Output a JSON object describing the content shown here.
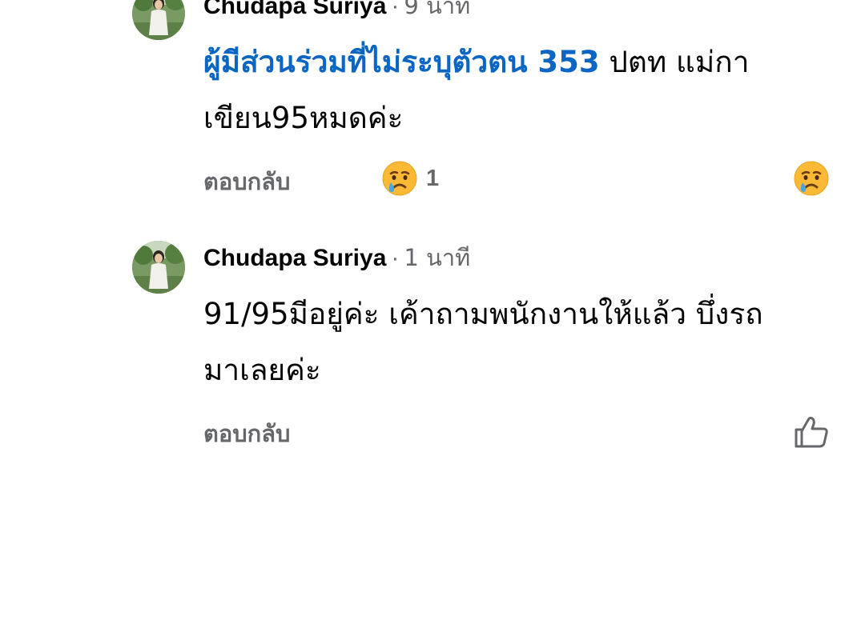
{
  "comments": [
    {
      "author": "Chudapa Suriya",
      "separator": "·",
      "time": "9 นาที",
      "mention": "ผู้มีส่วนร่วมที่ไม่ระบุตัวตน 353",
      "text_line1": " ปตท แม่กา",
      "text_line2": "เขียน95หมดค่ะ",
      "reply_label": "ตอบกลับ",
      "reaction_icon": "sad-face-icon",
      "reaction_count": "1",
      "user_reaction_icon": "sad-face-icon"
    },
    {
      "author": "Chudapa Suriya",
      "separator": "·",
      "time": "1 นาที",
      "text_line1": "91/95มีอยู่ค่ะ เค้าถามพนักงานให้แล้ว บึ่งรถ",
      "text_line2": "มาเลยค่ะ",
      "reply_label": "ตอบกลับ",
      "user_reaction_icon": "thumbs-up-icon"
    }
  ],
  "colors": {
    "mention": "#0a66c2",
    "meta": "#65676b",
    "text": "#050505",
    "emoji_face": "#fbb935",
    "emoji_tear": "#4aa3df"
  }
}
